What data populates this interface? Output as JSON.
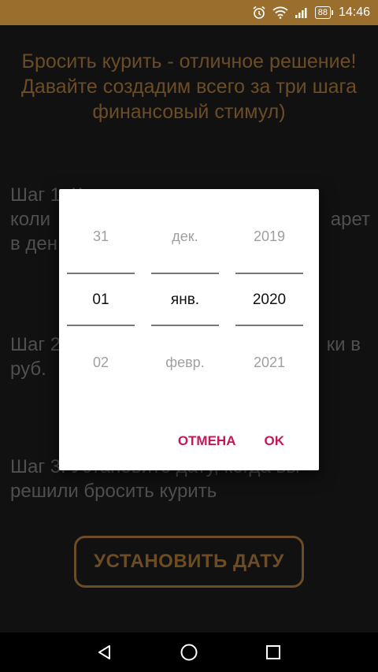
{
  "status_bar": {
    "battery": "88",
    "time": "14:46",
    "icons": [
      "alarm-icon",
      "wifi-icon",
      "signal-icon",
      "battery-icon"
    ]
  },
  "app": {
    "intro": "Бросить курить - отличное решение! Давайте создадим всего за три шага финансовый стимул)",
    "step1_prefix": "Шаг 1. К",
    "step1_line2_start": "коли",
    "step1_line2_end": "арет",
    "step1_line3": "в ден",
    "step2_start": "Шаг 2",
    "step2_end": "ки в",
    "step2_line2": "руб.",
    "step3_line1": "Шаг 3. Установите дату, когда вы",
    "step3_line2": "решили бросить курить",
    "set_date_button": "УСТАНОВИТЬ ДАТУ"
  },
  "date_dialog": {
    "day": {
      "prev": "31",
      "current": "01",
      "next": "02"
    },
    "month": {
      "prev": "дек.",
      "current": "янв.",
      "next": "февр."
    },
    "year": {
      "prev": "2019",
      "current": "2020",
      "next": "2021"
    },
    "cancel_label": "ОТМЕНА",
    "ok_label": "OK"
  },
  "colors": {
    "accent": "#a5763a",
    "status_bar": "#9a6f2e",
    "dialog_action": "#c2185b",
    "background": "#1b1b1b"
  },
  "nav_bar": [
    "back-icon",
    "home-icon",
    "recents-icon"
  ]
}
